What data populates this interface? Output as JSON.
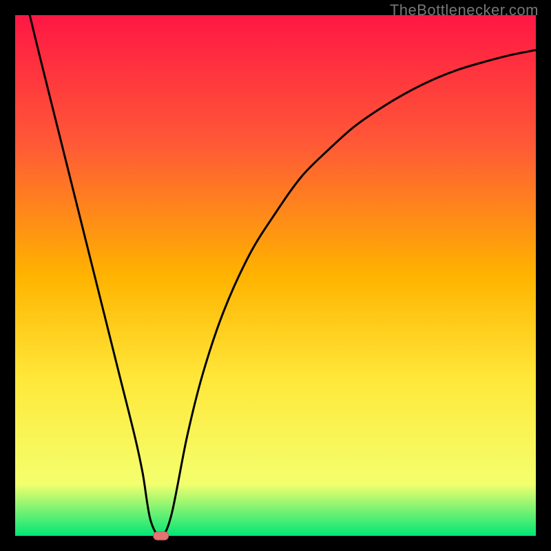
{
  "watermark": "TheBottlenecker.com",
  "colors": {
    "gradient_top": "#ff1744",
    "gradient_mid1": "#ff5a36",
    "gradient_mid2": "#ffb300",
    "gradient_mid3": "#ffe83a",
    "gradient_mid4": "#f4ff6e",
    "gradient_bottom": "#00e676",
    "curve": "#000000",
    "marker_fill": "#e57373",
    "marker_stroke": "#c75b5b",
    "frame": "#000000"
  },
  "chart_data": {
    "type": "line",
    "title": "",
    "xlabel": "",
    "ylabel": "",
    "xlim": [
      0,
      100
    ],
    "ylim": [
      0,
      100
    ],
    "x": [
      2.8,
      5,
      8,
      11,
      14,
      17,
      20,
      23,
      24.5,
      26,
      28,
      30,
      33,
      36,
      40,
      45,
      50,
      55,
      60,
      65,
      70,
      75,
      80,
      85,
      90,
      95,
      100
    ],
    "values": [
      100,
      91,
      79,
      67,
      55,
      43,
      31,
      19,
      12,
      3,
      0,
      4,
      19,
      31,
      43,
      54,
      62,
      69,
      74,
      78.5,
      82,
      85,
      87.5,
      89.5,
      91,
      92.3,
      93.3
    ],
    "marker": {
      "x": 28,
      "y": 0
    },
    "legend": []
  }
}
